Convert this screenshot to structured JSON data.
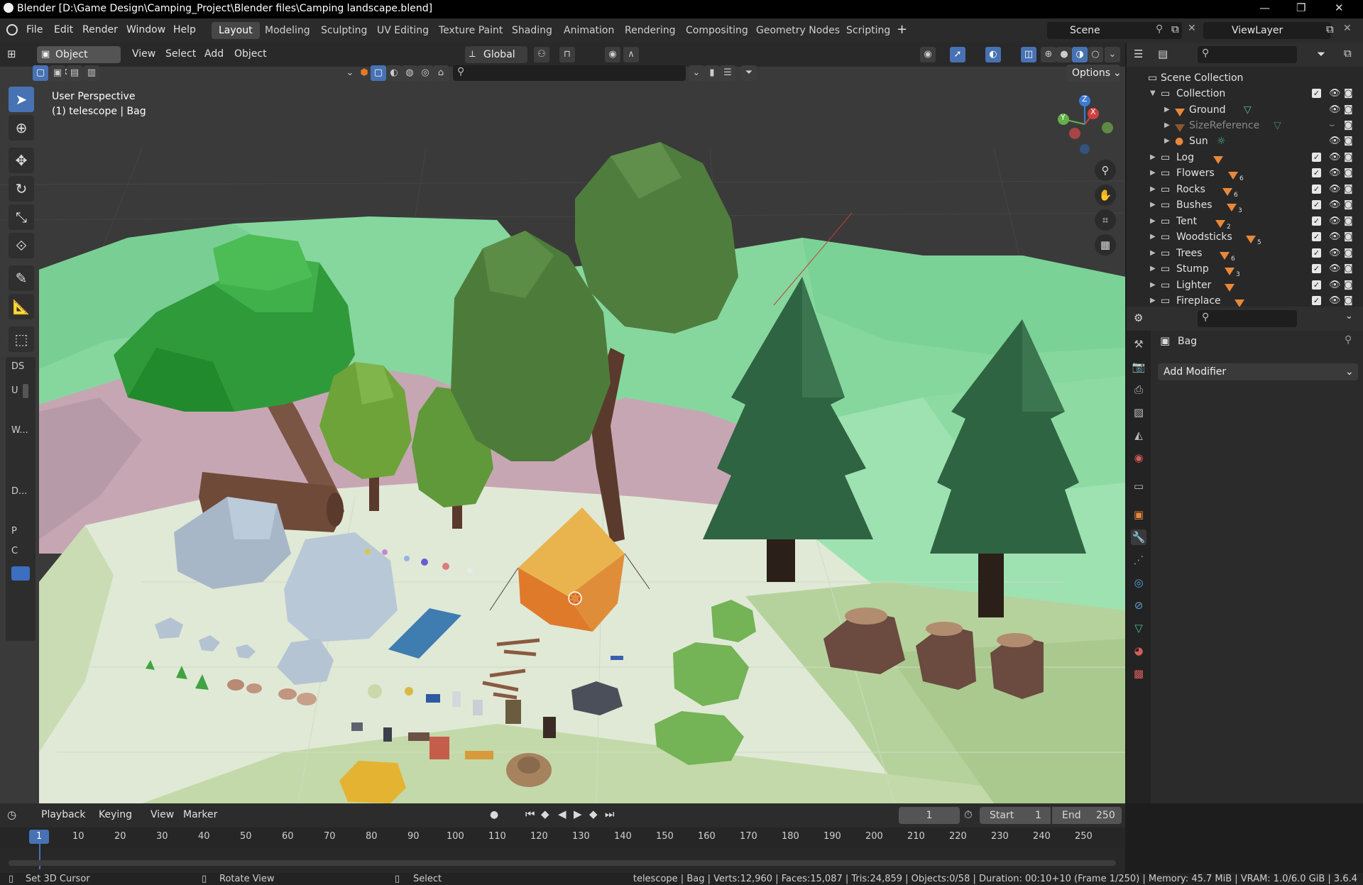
{
  "window": {
    "title": "Blender [D:\\Game Design\\Camping_Project\\Blender files\\Camping landscape.blend]"
  },
  "menus": [
    "File",
    "Edit",
    "Render",
    "Window",
    "Help"
  ],
  "workspaces": [
    "Layout",
    "Modeling",
    "Sculpting",
    "UV Editing",
    "Texture Paint",
    "Shading",
    "Animation",
    "Rendering",
    "Compositing",
    "Geometry Nodes",
    "Scripting"
  ],
  "scene": {
    "name": "Scene",
    "view_layer": "ViewLayer"
  },
  "viewport": {
    "mode": "Object Mode",
    "menus": [
      "View",
      "Select",
      "Add",
      "Object"
    ],
    "transform": "Global",
    "options_label": "Options",
    "overlay_line1": "User Perspective",
    "overlay_line2": "(1) telescope | Bag",
    "gizmo": {
      "x": "X",
      "y": "Y",
      "z": "Z"
    }
  },
  "npanel": {
    "tab": "DS",
    "labels": [
      "U",
      "W...",
      "D...",
      "P",
      "C"
    ]
  },
  "outliner": {
    "root": "Scene Collection",
    "collection": "Collection",
    "children": [
      {
        "name": "Ground",
        "dim": false
      },
      {
        "name": "SizeReference",
        "dim": true
      },
      {
        "name": "Sun",
        "dim": false
      }
    ],
    "items": [
      {
        "name": "Log",
        "count": ""
      },
      {
        "name": "Flowers",
        "count": "6"
      },
      {
        "name": "Rocks",
        "count": "6"
      },
      {
        "name": "Bushes",
        "count": "3"
      },
      {
        "name": "Tent",
        "count": "2"
      },
      {
        "name": "Woodsticks",
        "count": "5"
      },
      {
        "name": "Trees",
        "count": "6"
      },
      {
        "name": "Stump",
        "count": "3"
      },
      {
        "name": "Lighter",
        "count": ""
      },
      {
        "name": "Fireplace",
        "count": ""
      }
    ]
  },
  "properties": {
    "object_name": "Bag",
    "add_modifier": "Add Modifier"
  },
  "timeline": {
    "menus": [
      "Playback",
      "Keying",
      "View",
      "Marker"
    ],
    "current_frame": "1",
    "start_label": "Start",
    "start": "1",
    "end_label": "End",
    "end": "250",
    "ticks": [
      "1",
      "10",
      "20",
      "30",
      "40",
      "50",
      "60",
      "70",
      "80",
      "90",
      "100",
      "110",
      "120",
      "130",
      "140",
      "150",
      "160",
      "170",
      "180",
      "190",
      "200",
      "210",
      "220",
      "230",
      "240",
      "250"
    ]
  },
  "statusbar": {
    "hint1": "Set 3D Cursor",
    "hint2": "Rotate View",
    "hint3": "Select",
    "info": "telescope | Bag | Verts:12,960 | Faces:15,087 | Tris:24,859 | Objects:0/58 | Duration: 00:10+10 (Frame 1/250) | Memory: 45.7 MiB | VRAM: 1.0/6.0 GiB | 3.6.4"
  },
  "colors": {
    "accent": "#4772b3",
    "object_orange": "#e8883a",
    "ground_green": "#8fd9a0"
  }
}
